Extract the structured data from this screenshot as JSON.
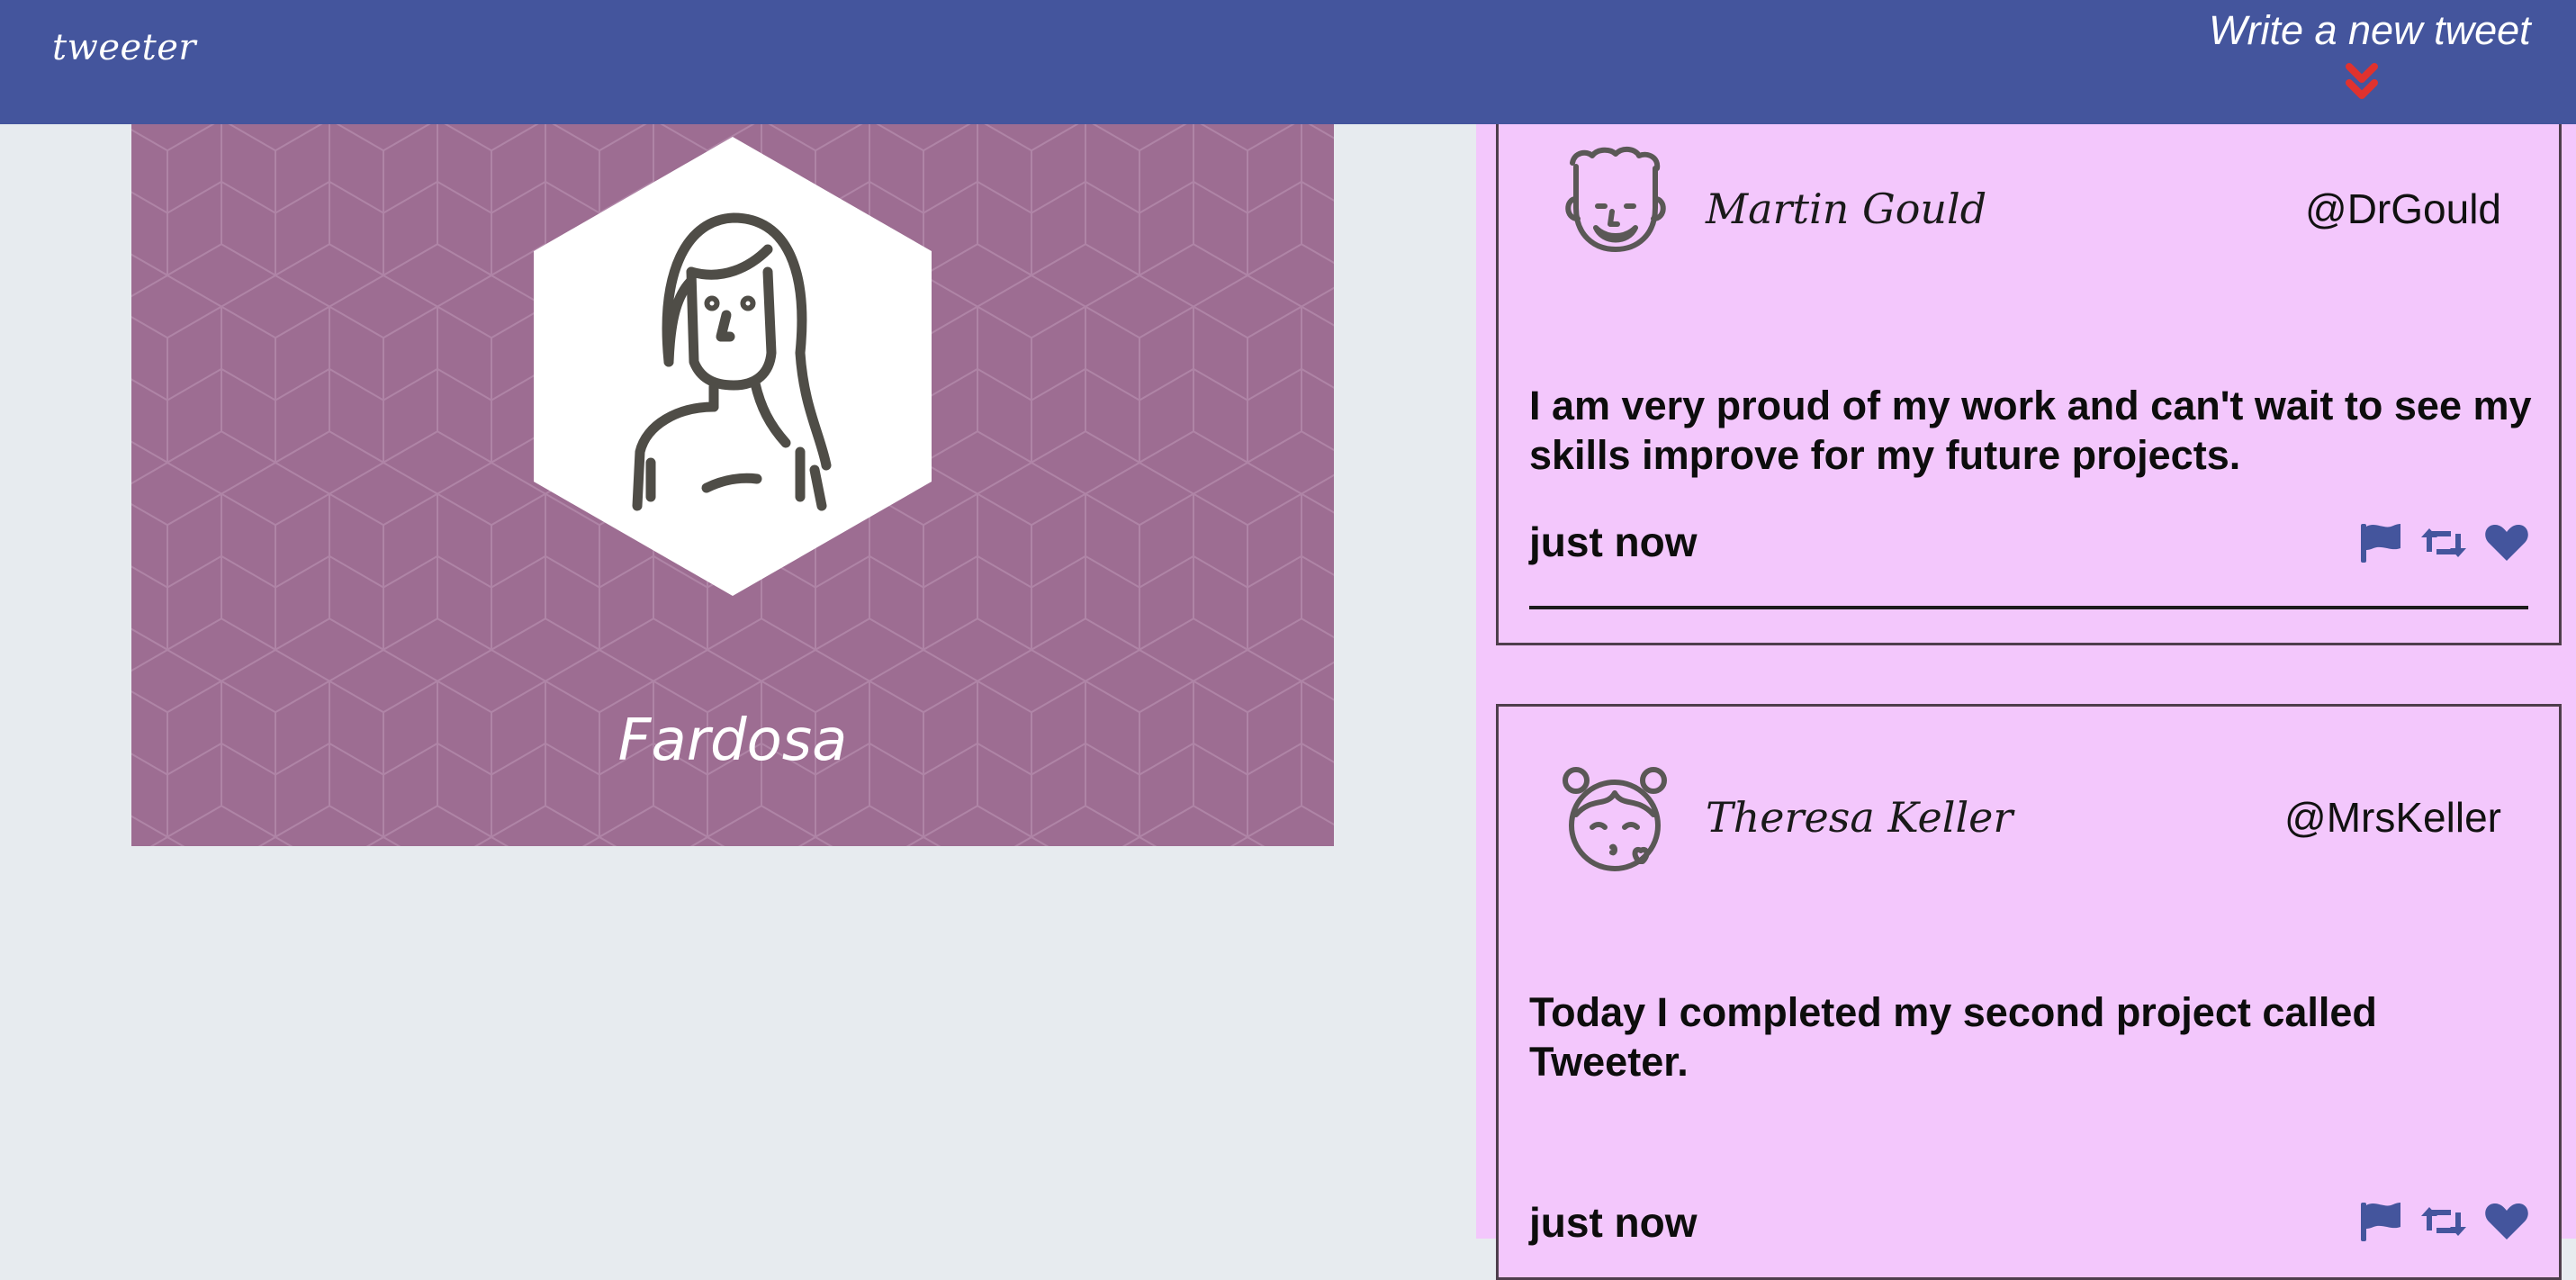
{
  "nav": {
    "brand": "tweeter",
    "compose_label": "Write a new tweet",
    "compose_icon": "double-chevron-down-icon",
    "compose_icon_color": "#e0322e"
  },
  "profile": {
    "name": "Fardosa",
    "avatar": "woman-avatar-icon",
    "background_color": "#9d6d92"
  },
  "tweets": [
    {
      "avatar": "man-avatar-icon",
      "name": "Martin Gould",
      "handle": "@DrGould",
      "text": "I am very proud of my work and can't wait to see my skills improve for my future projects.",
      "time": "just now",
      "actions": [
        "flag-icon",
        "retweet-icon",
        "heart-icon"
      ]
    },
    {
      "avatar": "woman-bun-avatar-icon",
      "name": "Theresa Keller",
      "handle": "@MrsKeller",
      "text": "Today I completed my second project called Tweeter.",
      "time": "just now",
      "actions": [
        "flag-icon",
        "retweet-icon",
        "heart-icon"
      ]
    }
  ],
  "colors": {
    "nav": "#44559d",
    "feed_bg": "#f3c7fc",
    "page_bg": "#e7ebef",
    "action_icons": "#44559d"
  }
}
